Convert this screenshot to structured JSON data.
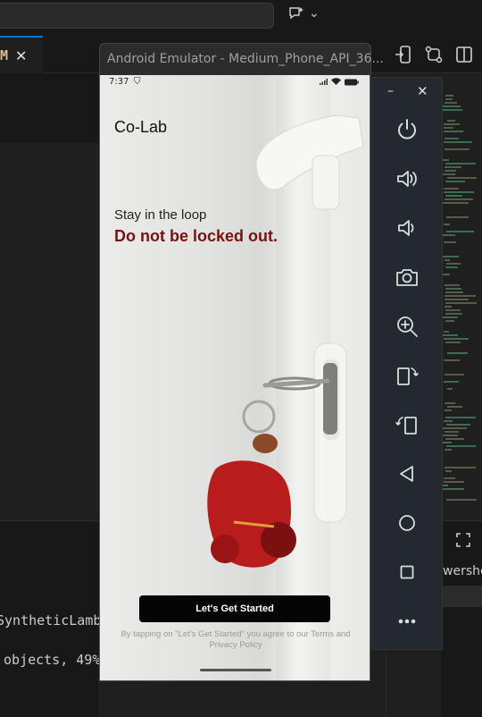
{
  "ide": {
    "tab_label": "M",
    "tab_close": "✕",
    "terminal_lines": [
      "SyntheticLamb",
      "objects, 49%"
    ],
    "terminal_panel_label": "wershel"
  },
  "emulator": {
    "window_title": "Android Emulator - Medium_Phone_API_36...",
    "toolbar": {
      "minimize": "–",
      "close": "✕",
      "buttons": [
        "power-icon",
        "volume-up-icon",
        "volume-down-icon",
        "camera-icon",
        "zoom-icon",
        "rotate-left-icon",
        "rotate-right-icon",
        "back-icon",
        "home-icon",
        "overview-icon",
        "more-icon"
      ]
    }
  },
  "phone": {
    "status_time": "7:37",
    "app_name": "Co-Lab",
    "subtitle": "Stay in the loop",
    "headline": "Do not be locked out.",
    "cta_label": "Let's Get Started",
    "terms_text": "By tapping on \"Let's Get Started\" you agree to our Terms and Privacy Policy",
    "headline_color": "#7a1010"
  }
}
